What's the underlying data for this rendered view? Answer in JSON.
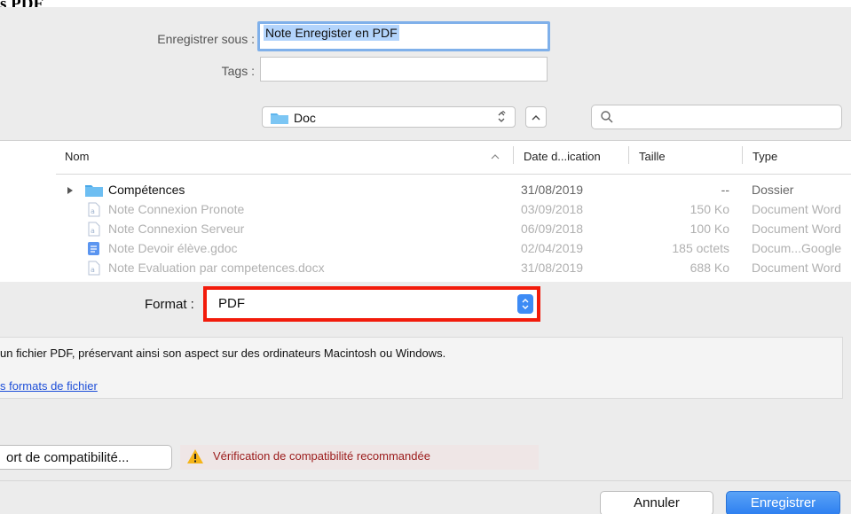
{
  "top_fragment": "s PDF",
  "save_as": {
    "label": "Enregistrer sous :",
    "value": "Note Enregister en PDF"
  },
  "tags": {
    "label": "Tags :",
    "value": ""
  },
  "location": {
    "folder": "Doc",
    "search_placeholder": ""
  },
  "columns": {
    "name": "Nom",
    "date": "Date d...ication",
    "size": "Taille",
    "type": "Type"
  },
  "files": [
    {
      "name": "Compétences",
      "date": "31/08/2019",
      "size": "--",
      "type": "Dossier",
      "icon": "folder-icon",
      "state": "enabled"
    },
    {
      "name": "Note Connexion Pronote",
      "date": "03/09/2018",
      "size": "150 Ko",
      "type": "Document Word",
      "icon": "word-doc-icon",
      "state": "dimmed"
    },
    {
      "name": "Note Connexion Serveur",
      "date": "06/09/2018",
      "size": "100 Ko",
      "type": "Document Word",
      "icon": "word-doc-icon",
      "state": "dimmed"
    },
    {
      "name": "Note Devoir élève.gdoc",
      "date": "02/04/2019",
      "size": "185 octets",
      "type": "Docum...Google",
      "icon": "gdoc-icon",
      "state": "dimmed"
    },
    {
      "name": "Note Evaluation par competences.docx",
      "date": "31/08/2019",
      "size": "688 Ko",
      "type": "Document Word",
      "icon": "word-doc-icon",
      "state": "dimmed"
    }
  ],
  "format": {
    "label": "Format :",
    "value": "PDF",
    "highlight_color": "#f21b0b"
  },
  "info": {
    "description": "un fichier PDF, préservant ainsi son aspect sur des ordinateurs Macintosh ou Windows.",
    "link": "s formats de fichier"
  },
  "compat": {
    "button": "ort de compatibilité...",
    "warning": "Vérification de compatibilité recommandée"
  },
  "buttons": {
    "cancel": "Annuler",
    "save": "Enregistrer"
  },
  "colors": {
    "accent": "#3d8bf5",
    "warning_text": "#9b1b1b",
    "link": "#1d4ed8"
  }
}
